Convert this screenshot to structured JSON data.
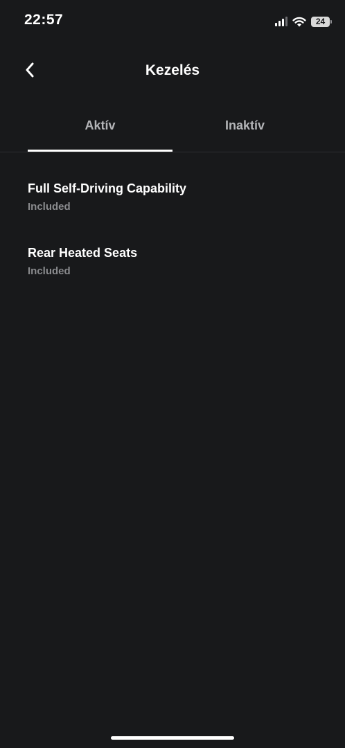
{
  "status_bar": {
    "time": "22:57",
    "battery_level": "24",
    "icons": [
      "signal-icon",
      "wifi-icon",
      "battery-icon"
    ]
  },
  "header": {
    "title": "Kezelés",
    "back_icon": "chevron-left-icon"
  },
  "tabs": [
    {
      "label": "Aktív",
      "active": true
    },
    {
      "label": "Inaktív",
      "active": false
    }
  ],
  "features": [
    {
      "name": "Full Self-Driving Capability",
      "status": "Included"
    },
    {
      "name": "Rear Heated Seats",
      "status": "Included"
    }
  ],
  "colors": {
    "background": "#18191b",
    "text_primary": "#ffffff",
    "text_secondary": "#8a8b8e",
    "tab_inactive": "#b4b5b8",
    "divider": "#2e2f32"
  }
}
